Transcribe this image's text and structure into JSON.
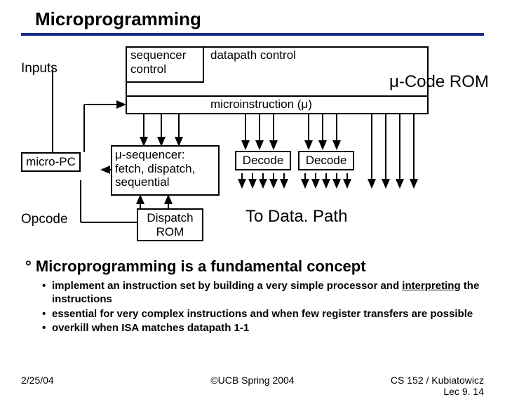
{
  "title": "Microprogramming",
  "labels": {
    "inputs": "Inputs",
    "seq_ctrl": "sequencer control",
    "dp_ctrl": "datapath control",
    "rom": "-Code ROM",
    "microinstr": "microinstruction (",
    "microinstr_close": ")",
    "micro_pc": "micro-PC",
    "mseq1": "-sequencer:",
    "mseq2": "fetch, dispatch, sequential",
    "decode": "Decode",
    "opcode": "Opcode",
    "dispatch": "Dispatch ROM",
    "to_dp": "To Data. Path"
  },
  "bullets": {
    "headline": "Microprogramming is a fundamental concept",
    "items": [
      {
        "pre": "implement an instruction set by building a very simple processor and ",
        "u": "interpreting",
        "post": " the instructions"
      },
      {
        "pre": "essential for very complex instructions and when few register transfers are possible",
        "u": "",
        "post": ""
      },
      {
        "pre": "overkill when ISA matches datapath 1-1",
        "u": "",
        "post": ""
      }
    ]
  },
  "footer": {
    "date": "2/25/04",
    "mid": "©UCB Spring 2004",
    "right1": "CS 152 / Kubiatowicz",
    "right2": "Lec 9. 14"
  },
  "mu": "μ"
}
